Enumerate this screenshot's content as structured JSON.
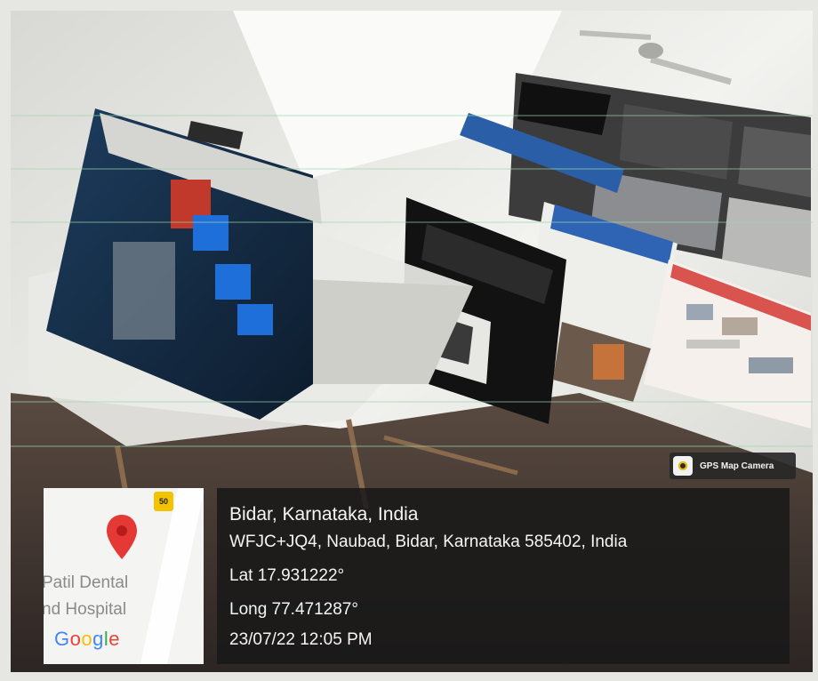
{
  "badge": {
    "label": "GPS Map Camera",
    "icon": "camera-icon"
  },
  "map": {
    "marker_label": "50",
    "place_line1": "Patil Dental",
    "place_line2": "nd Hospital",
    "logo_letters": [
      "G",
      "o",
      "o",
      "g",
      "l",
      "e"
    ],
    "logo_colors": [
      "#4285F4",
      "#EA4335",
      "#FBBC05",
      "#4285F4",
      "#34A853",
      "#EA4335"
    ],
    "pin_color": "#e53935"
  },
  "location": {
    "city": "Bidar, Karnataka, India",
    "address": "WFJC+JQ4, Naubad, Bidar, Karnataka 585402, India",
    "lat": "Lat 17.931222°",
    "long": "Long 77.471287°",
    "datetime": "23/07/22 12:05 PM"
  }
}
